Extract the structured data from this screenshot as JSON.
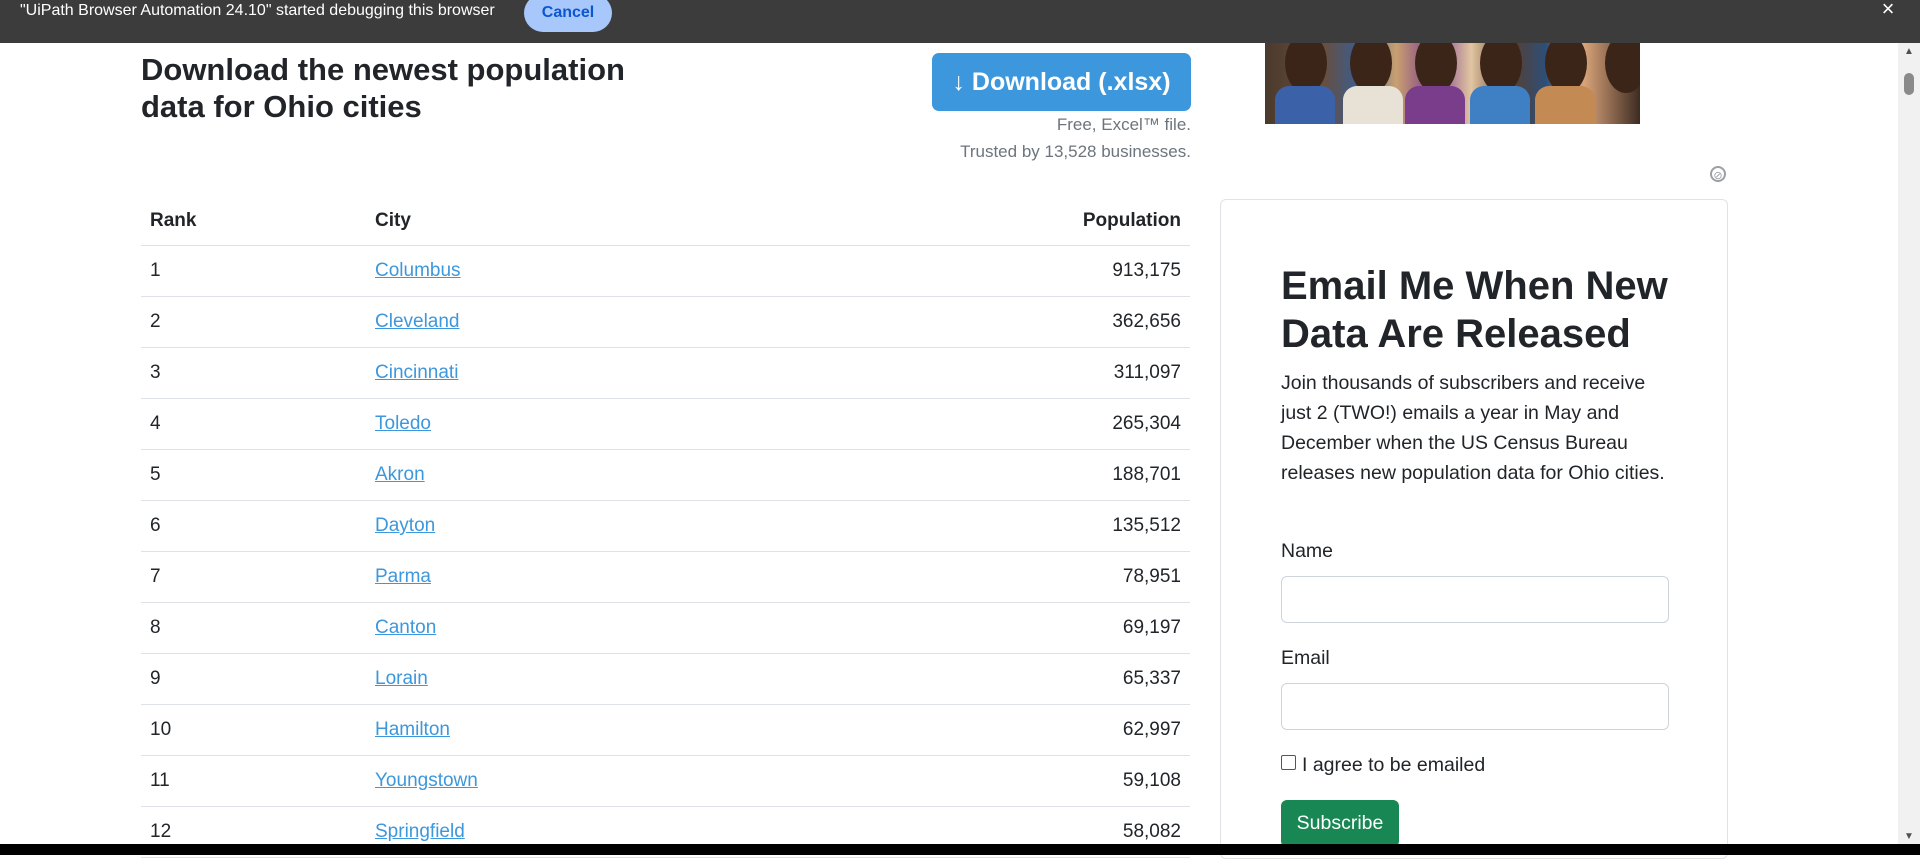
{
  "banner": {
    "text": "\"UiPath Browser Automation 24.10\" started debugging this browser",
    "cancel_label": "Cancel",
    "close_icon": "×"
  },
  "header": {
    "title": "Download the newest population data for Ohio cities",
    "download_label": "↓ Download (.xlsx)",
    "note_line1": "Free, Excel™ file.",
    "note_line2": "Trusted by 13,528 businesses."
  },
  "table": {
    "columns": [
      "Rank",
      "City",
      "Population"
    ],
    "rows": [
      {
        "rank": "1",
        "city": "Columbus",
        "population": "913,175"
      },
      {
        "rank": "2",
        "city": "Cleveland",
        "population": "362,656"
      },
      {
        "rank": "3",
        "city": "Cincinnati",
        "population": "311,097"
      },
      {
        "rank": "4",
        "city": "Toledo",
        "population": "265,304"
      },
      {
        "rank": "5",
        "city": "Akron",
        "population": "188,701"
      },
      {
        "rank": "6",
        "city": "Dayton",
        "population": "135,512"
      },
      {
        "rank": "7",
        "city": "Parma",
        "population": "78,951"
      },
      {
        "rank": "8",
        "city": "Canton",
        "population": "69,197"
      },
      {
        "rank": "9",
        "city": "Lorain",
        "population": "65,337"
      },
      {
        "rank": "10",
        "city": "Hamilton",
        "population": "62,997"
      },
      {
        "rank": "11",
        "city": "Youngstown",
        "population": "59,108"
      },
      {
        "rank": "12",
        "city": "Springfield",
        "population": "58,082"
      }
    ]
  },
  "subscribe": {
    "title": "Email Me When New Data Are Released",
    "description": "Join thousands of subscribers and receive just 2 (TWO!) emails a year in May and December when the US Census Bureau releases new population data for Ohio cities.",
    "name_label": "Name",
    "name_value": "",
    "email_label": "Email",
    "email_value": "",
    "agree_label": "I agree to be emailed",
    "button_label": "Subscribe"
  },
  "colors": {
    "banner_bg": "#3c3c3c",
    "link": "#3d97dc",
    "download_button": "#3d97dc",
    "subscribe_button": "#198754"
  }
}
